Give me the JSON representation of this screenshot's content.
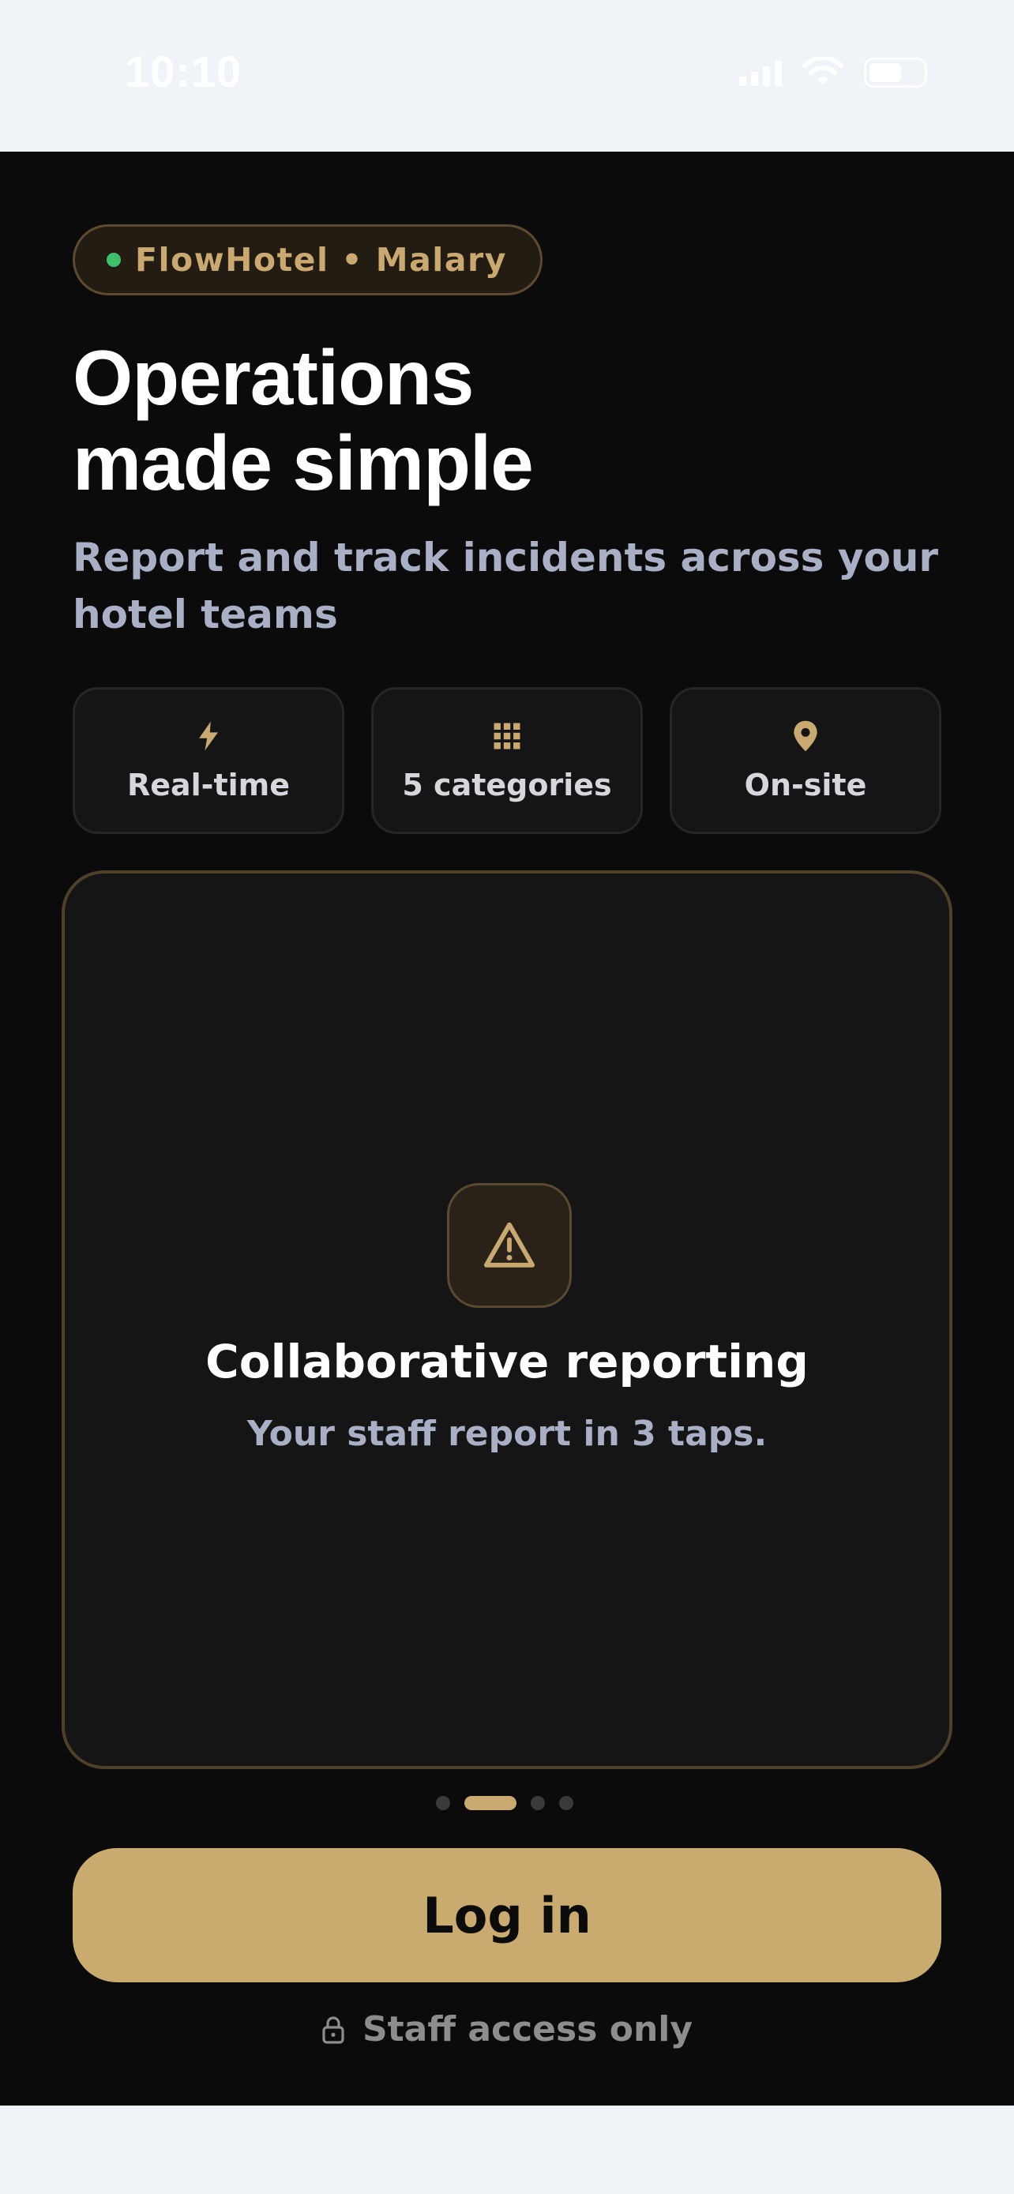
{
  "status_bar": {
    "time": "10:10"
  },
  "brand": {
    "label": "FlowHotel • Malary",
    "dot_color": "#3fbf6a"
  },
  "hero": {
    "title_line1": "Operations",
    "title_line2": "made simple",
    "subtitle": "Report and track incidents across your hotel teams"
  },
  "features": [
    {
      "icon": "lightning-icon",
      "label": "Real-time"
    },
    {
      "icon": "grid-icon",
      "label": "5 categories"
    },
    {
      "icon": "location-pin-icon",
      "label": "On-site"
    }
  ],
  "carousel": {
    "icon": "warning-triangle-icon",
    "title": "Collaborative reporting",
    "subtitle": "Your staff report in 3 taps.",
    "page_count": 4,
    "active_index": 1
  },
  "login_button": {
    "label": "Log in"
  },
  "footer_note": {
    "icon": "lock-icon",
    "text": "Staff access only"
  },
  "colors": {
    "accent": "#c9aa6f",
    "background": "#0b0b0b",
    "card": "#151515"
  }
}
